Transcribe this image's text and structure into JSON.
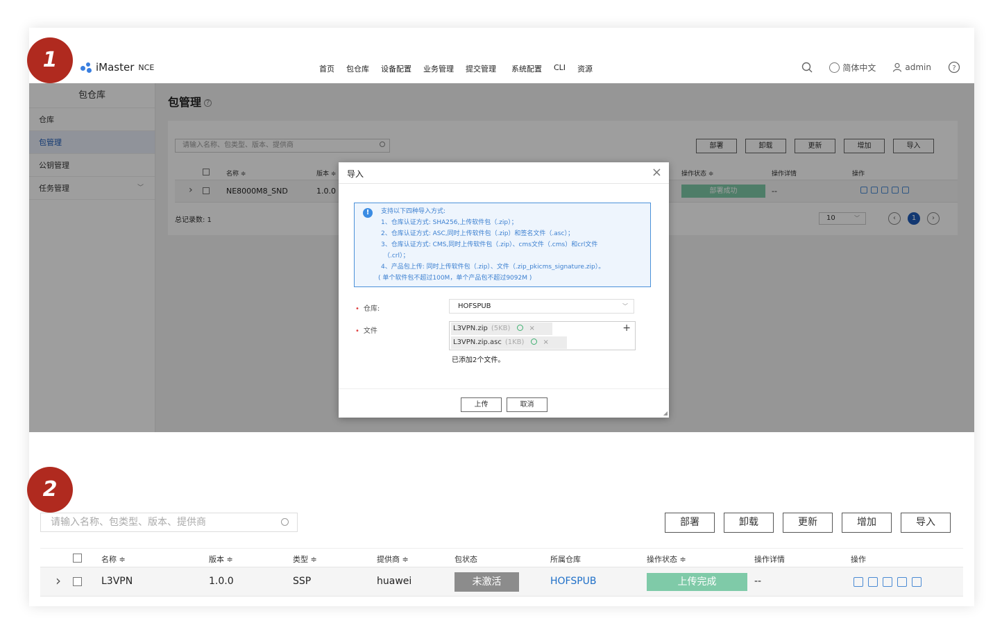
{
  "steps": [
    "1",
    "2"
  ],
  "app": {
    "name": "iMaster",
    "suffix": "NCE"
  },
  "nav": [
    "首页",
    "包仓库",
    "设备配置",
    "业务管理",
    "提交管理",
    "系统配置",
    "CLI",
    "资源"
  ],
  "header_tools": {
    "language": "简体中文",
    "user": "admin"
  },
  "sidebar": {
    "title": "包仓库",
    "items": [
      {
        "label": "仓库",
        "active": false
      },
      {
        "label": "包管理",
        "active": true
      },
      {
        "label": "公钥管理",
        "active": false
      },
      {
        "label": "任务管理",
        "active": false
      }
    ]
  },
  "page": {
    "title": "包管理"
  },
  "toolbar": {
    "search_placeholder": "请输入名称、包类型、版本、提供商",
    "buttons": [
      "部署",
      "卸载",
      "更新",
      "增加",
      "导入"
    ]
  },
  "table1": {
    "headers": [
      "名称 ≑",
      "版本 ≑",
      "操作状态 ≑",
      "操作详情",
      "操作"
    ],
    "row": {
      "name": "NE8000M8_SND",
      "version": "1.0.0",
      "op_status": "部署成功",
      "op_detail": "--"
    },
    "total": "总记录数: 1",
    "page_size": "10",
    "current_page": "1"
  },
  "dialog": {
    "title": "导入",
    "notice_lines": [
      "支持以下四种导入方式:",
      "1、仓库认证方式: SHA256,上传软件包（.zip）；",
      "2、仓库认证方式: ASC,同时上传软件包（.zip）和签名文件（.asc）；",
      "3、仓库认证方式: CMS,同时上传软件包（.zip）、cms文件（.cms）和crl文件",
      "（.crl）；",
      "4、产品包上传: 同时上传软件包（.zip）、文件（.zip_pkicms_signature.zip）。",
      "( 单个软件包不超过100M，单个产品包不超过9092M )"
    ],
    "repo_label": "仓库:",
    "repo_value": "HOFSPUB",
    "file_label": "文件",
    "files": [
      {
        "name": "L3VPN.zip",
        "size": "(5KB)"
      },
      {
        "name": "L3VPN.zip.asc",
        "size": "(1KB)"
      }
    ],
    "added_text": "已添加2个文件。",
    "upload_label": "上传",
    "cancel_label": "取消"
  },
  "table2": {
    "headers": [
      "名称 ≑",
      "版本 ≑",
      "类型 ≑",
      "提供商 ≑",
      "包状态",
      "所属仓库",
      "操作状态 ≑",
      "操作详情",
      "操作"
    ],
    "row": {
      "name": "L3VPN",
      "version": "1.0.0",
      "type": "SSP",
      "vendor": "huawei",
      "pkg_status": "未激活",
      "repo": "HOFSPUB",
      "op_status": "上传完成",
      "op_detail": "--"
    }
  },
  "colors": {
    "marker": "#b02a1f",
    "accent": "#1e5bb8",
    "success": "#7fcaa8",
    "inactive": "#8c8c8c"
  }
}
